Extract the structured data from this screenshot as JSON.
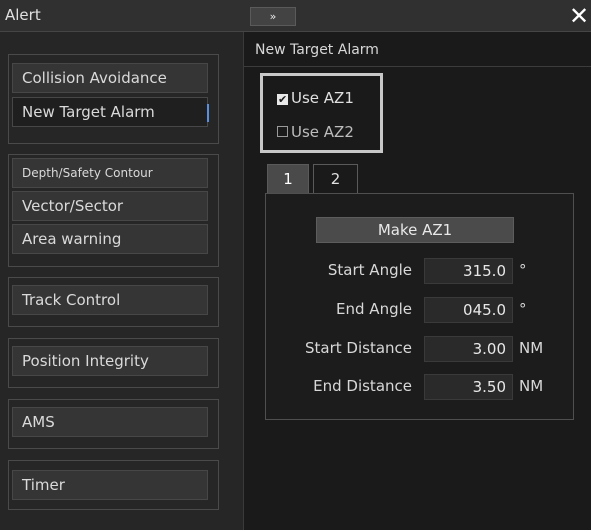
{
  "window": {
    "title": "Alert",
    "expand_label": "»",
    "close_label": "✕"
  },
  "sidebar": {
    "collision_avoidance": "Collision Avoidance",
    "new_target_alarm": "New Target Alarm",
    "depth_safety_contour": "Depth/Safety Contour",
    "vector_sector": "Vector/Sector",
    "area_warning": "Area warning",
    "track_control": "Track Control",
    "position_integrity": "Position Integrity",
    "ams": "AMS",
    "timer": "Timer"
  },
  "main": {
    "title": "New Target Alarm",
    "use_az1": {
      "label": "Use AZ1",
      "checked": true,
      "mark": "✔"
    },
    "use_az2": {
      "label": "Use AZ2",
      "checked": false,
      "mark": ""
    },
    "tabs": [
      "1",
      "2"
    ],
    "make_button": "Make AZ1",
    "rows": [
      {
        "label": "Start Angle",
        "value": "315.0",
        "unit": "°"
      },
      {
        "label": "End Angle",
        "value": "045.0",
        "unit": "°"
      },
      {
        "label": "Start Distance",
        "value": "3.00",
        "unit": "NM"
      },
      {
        "label": "End Distance",
        "value": "3.50",
        "unit": "NM"
      }
    ]
  },
  "colors": {
    "accent": "#5a8fe0",
    "background": "#1a1a1a",
    "panel": "#262626",
    "button": "#353535"
  }
}
